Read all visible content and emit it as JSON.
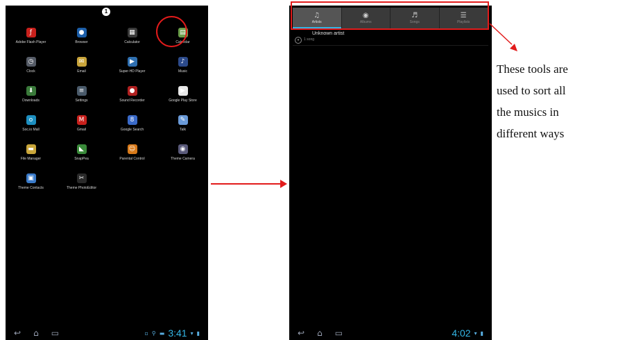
{
  "left_screen": {
    "page_indicator": "1",
    "apps": [
      {
        "label": "Adobe Flash Player",
        "icon": "flash-icon",
        "glyph": "ƒ",
        "color": "#c8201c"
      },
      {
        "label": "Browser",
        "icon": "globe-icon",
        "glyph": "●",
        "color": "#1c5ea8"
      },
      {
        "label": "Calculator",
        "icon": "calculator-icon",
        "glyph": "▦",
        "color": "#3a3a3a"
      },
      {
        "label": "Calendar",
        "icon": "calendar-icon",
        "glyph": "▤",
        "color": "#6a9e4a"
      },
      {
        "label": "Clock",
        "icon": "clock-icon",
        "glyph": "◷",
        "color": "#555b66"
      },
      {
        "label": "Email",
        "icon": "email-icon",
        "glyph": "✉",
        "color": "#c9a43a"
      },
      {
        "label": "Super-HD Player",
        "icon": "video-icon",
        "glyph": "▶",
        "color": "#2f6fb0"
      },
      {
        "label": "Music",
        "icon": "music-icon",
        "glyph": "♪",
        "color": "#2c4a8a"
      },
      {
        "label": "Downloads",
        "icon": "download-icon",
        "glyph": "⬇",
        "color": "#3a7a3a"
      },
      {
        "label": "Settings",
        "icon": "settings-icon",
        "glyph": "≡",
        "color": "#4a5a6a"
      },
      {
        "label": "Sound Recorder",
        "icon": "microphone-icon",
        "glyph": "●",
        "color": "#b02020"
      },
      {
        "label": "Google Play Store",
        "icon": "play-store-icon",
        "glyph": "▶",
        "color": "#e8e8e8"
      },
      {
        "label": "Soc.io Mall",
        "icon": "socio-mall-icon",
        "glyph": "ο",
        "color": "#1d8fc0"
      },
      {
        "label": "Gmail",
        "icon": "gmail-icon",
        "glyph": "M",
        "color": "#c8201c"
      },
      {
        "label": "Google Search",
        "icon": "search-icon",
        "glyph": "8",
        "color": "#3a6ac8"
      },
      {
        "label": "Talk",
        "icon": "talk-icon",
        "glyph": "✎",
        "color": "#6a9ad8"
      },
      {
        "label": "File Manager",
        "icon": "folder-icon",
        "glyph": "▬",
        "color": "#c9a63a"
      },
      {
        "label": "SnapPea",
        "icon": "snappea-icon",
        "glyph": "◣",
        "color": "#3a8a3a"
      },
      {
        "label": "Parental Control",
        "icon": "parental-control-icon",
        "glyph": "☺",
        "color": "#d87a1a"
      },
      {
        "label": "Theme Camera",
        "icon": "camera-icon",
        "glyph": "◉",
        "color": "#5a5a7a"
      },
      {
        "label": "Theme Contacts",
        "icon": "contacts-icon",
        "glyph": "▣",
        "color": "#3a7ac8"
      },
      {
        "label": "Theme PhotoEditor",
        "icon": "photo-editor-icon",
        "glyph": "✂",
        "color": "#2a2a2a"
      }
    ],
    "status": {
      "time": "3:41",
      "signal": "▾",
      "battery": "▮",
      "notify_1": "▫",
      "notify_2": "⚲",
      "notify_3": "▬"
    },
    "nav": {
      "back": "↩",
      "home": "⌂",
      "recent": "▭"
    }
  },
  "right_screen": {
    "tabs": [
      {
        "label": "Artists",
        "icon": "artist-icon",
        "glyph": "♫"
      },
      {
        "label": "Albums",
        "icon": "album-icon",
        "glyph": "◉"
      },
      {
        "label": "Songs",
        "icon": "song-icon",
        "glyph": "♬"
      },
      {
        "label": "Playlists",
        "icon": "playlist-icon",
        "glyph": "☰"
      }
    ],
    "list": [
      {
        "title": "Unknown artist",
        "subtitle": "1 song"
      }
    ],
    "status": {
      "time": "4:02",
      "signal": "▾",
      "battery": "▮"
    },
    "nav": {
      "back": "↩",
      "home": "⌂",
      "recent": "▭"
    }
  },
  "annotation": {
    "lines": [
      "These tools are",
      "used to sort all",
      "the musics in",
      "different ways"
    ]
  },
  "colors": {
    "highlight": "#e21b1b",
    "accent": "#33b5e5"
  }
}
